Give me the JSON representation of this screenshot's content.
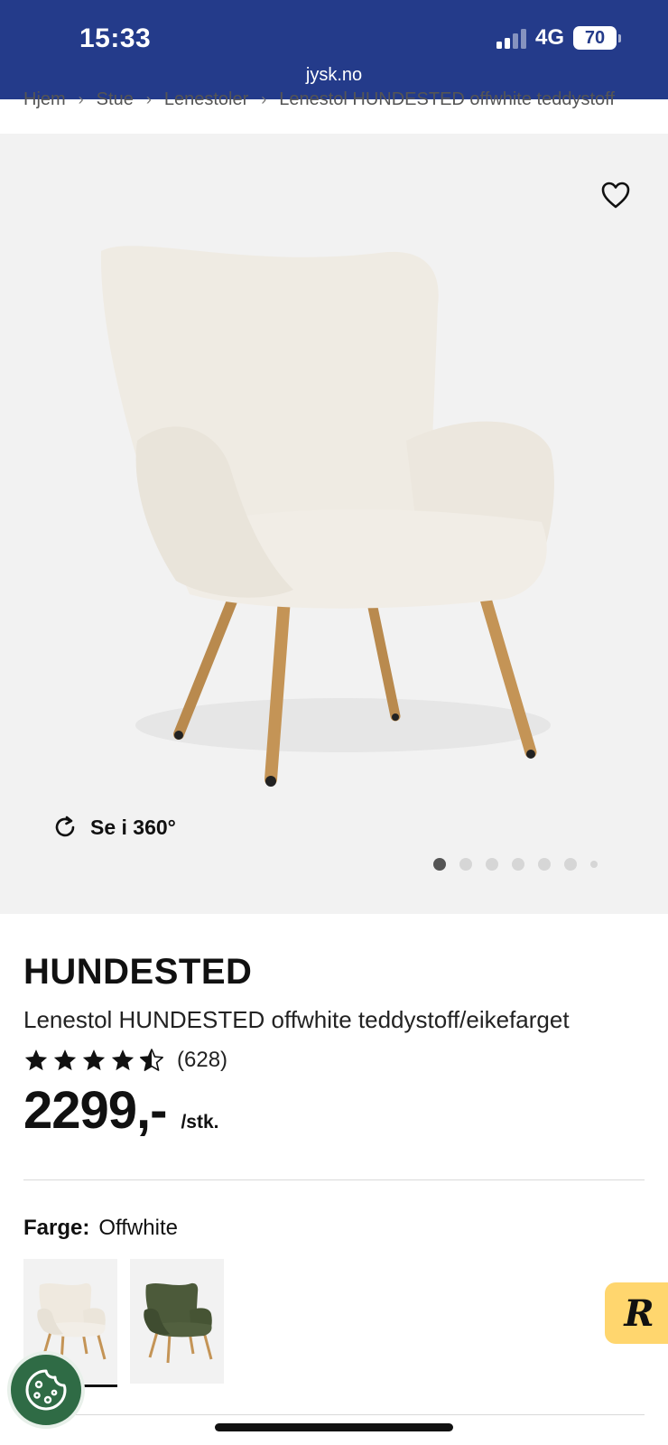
{
  "status_bar": {
    "time": "15:33",
    "network": "4G",
    "battery": "70",
    "url": "jysk.no",
    "background_color": "#243b8a"
  },
  "breadcrumb": [
    "Hjem",
    "Stue",
    "Lenestoler",
    "Lenestol HUNDESTED offwhite teddystoff"
  ],
  "gallery": {
    "rotate_label": "Se i 360°",
    "total_images": 7,
    "active_index": 0,
    "favorite_icon": "heart-outline-icon"
  },
  "product": {
    "brand": "HUNDESTED",
    "name": "Lenestol HUNDESTED offwhite teddystoff/eikefarget",
    "rating": 4.5,
    "review_count": "(628)",
    "price": "2299,-",
    "unit": "/stk."
  },
  "color": {
    "label": "Farge:",
    "value": "Offwhite",
    "options": [
      {
        "name": "offwhite",
        "swatch_color": "#efe9df",
        "selected": true
      },
      {
        "name": "green",
        "swatch_color": "#4c5a3a",
        "selected": false
      }
    ]
  },
  "floating": {
    "cookie_icon": "cookie-icon",
    "badge_letter": "R",
    "badge_color": "#ffd66e"
  }
}
